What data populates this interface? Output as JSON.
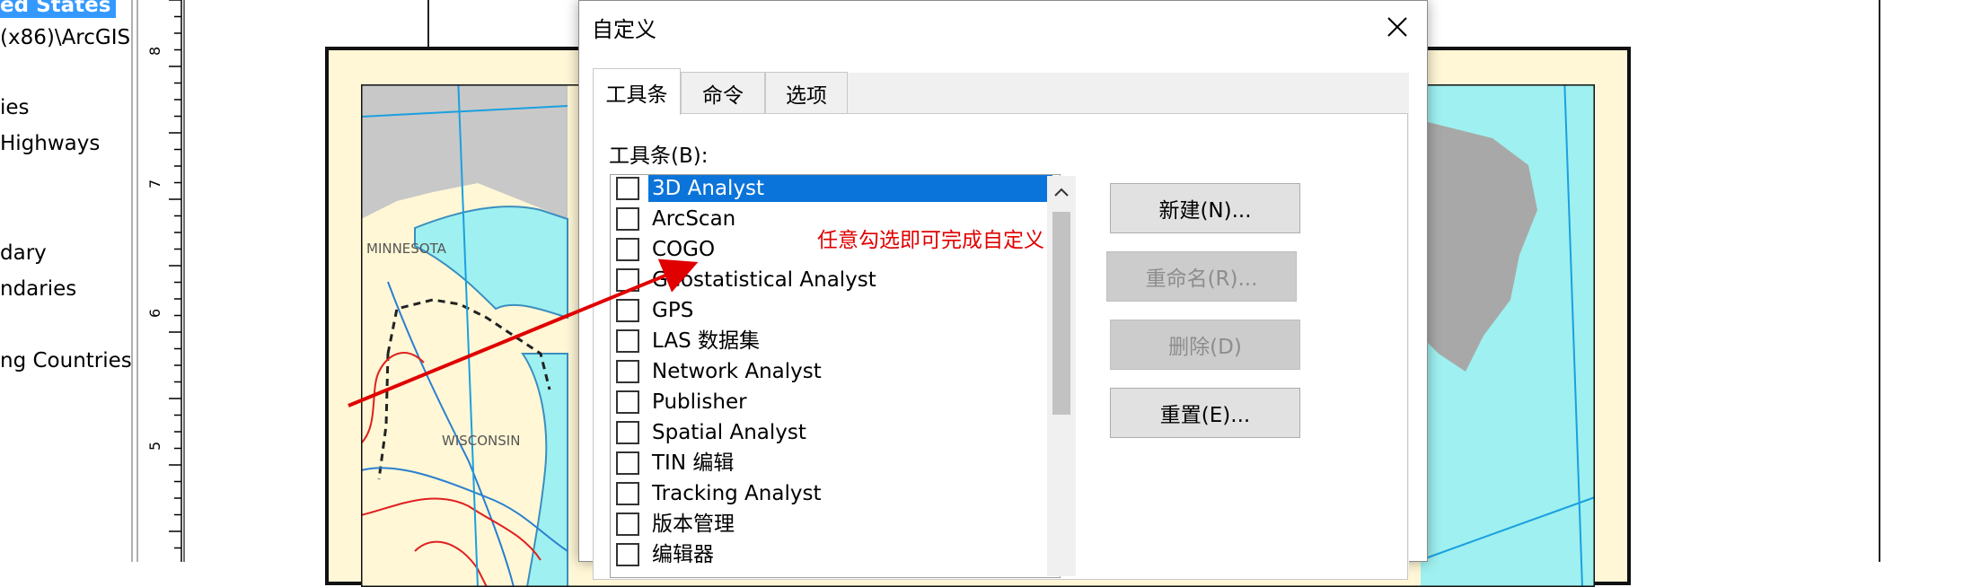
{
  "toc": {
    "items": [
      {
        "label": "ed States",
        "selected": true
      },
      {
        "label": "(x86)\\ArcGIS"
      },
      {
        "label": "ies"
      },
      {
        "label": "Highways"
      },
      {
        "label": "dary"
      },
      {
        "label": "ndaries"
      },
      {
        "label": "ng Countries"
      }
    ]
  },
  "ruler": {
    "labels": [
      "8",
      "7",
      "6",
      "5"
    ]
  },
  "map": {
    "labels": [
      "MINNESOTA",
      "WISCONSIN"
    ]
  },
  "dialog": {
    "title": "自定义",
    "tabs": [
      {
        "label": "工具条",
        "active": true
      },
      {
        "label": "命令"
      },
      {
        "label": "选项"
      }
    ],
    "toolbar_label": "工具条(B):",
    "toolbars": [
      {
        "label": "3D Analyst",
        "checked": false,
        "selected": true
      },
      {
        "label": "ArcScan",
        "checked": false
      },
      {
        "label": "COGO",
        "checked": false
      },
      {
        "label": "Geostatistical Analyst",
        "checked": false
      },
      {
        "label": "GPS",
        "checked": false
      },
      {
        "label": "LAS 数据集",
        "checked": false
      },
      {
        "label": "Network Analyst",
        "checked": false
      },
      {
        "label": "Publisher",
        "checked": false
      },
      {
        "label": "Spatial Analyst",
        "checked": false
      },
      {
        "label": "TIN 编辑",
        "checked": false
      },
      {
        "label": "Tracking Analyst",
        "checked": false
      },
      {
        "label": "版本管理",
        "checked": false
      },
      {
        "label": "编辑器",
        "checked": false
      }
    ],
    "buttons": {
      "new": "新建(N)...",
      "rename": "重命名(R)...",
      "delete": "删除(D)",
      "reset": "重置(E)..."
    }
  },
  "annotation": {
    "text": "任意勾选即可完成自定义",
    "color": "#e00000"
  },
  "colors": {
    "selection": "#0a74da",
    "toc_selection": "#3399ff",
    "lake": "#9ff0f0",
    "land": "#fff7d6",
    "canada": "#c8c8c8"
  }
}
